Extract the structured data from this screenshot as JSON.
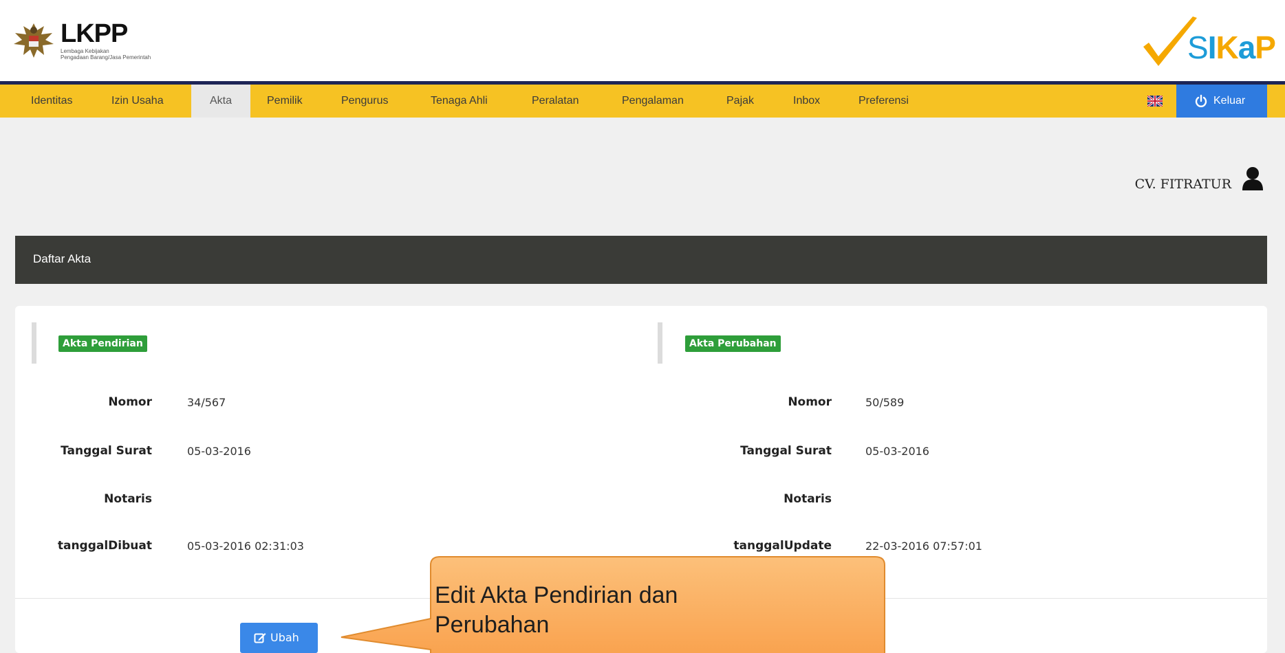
{
  "header": {
    "lkpp_brand": "LKPP",
    "lkpp_subtitle_1": "Lembaga Kebijakan",
    "lkpp_subtitle_2": "Pengadaan Barang/Jasa Pemerintah",
    "sikap_brand": "SIKaP"
  },
  "nav": {
    "items": [
      {
        "label": "Identitas"
      },
      {
        "label": "Izin Usaha"
      },
      {
        "label": "Akta"
      },
      {
        "label": "Pemilik"
      },
      {
        "label": "Pengurus"
      },
      {
        "label": "Tenaga Ahli"
      },
      {
        "label": "Peralatan"
      },
      {
        "label": "Pengalaman"
      },
      {
        "label": "Pajak"
      },
      {
        "label": "Inbox"
      },
      {
        "label": "Preferensi"
      }
    ],
    "active": "Akta",
    "logout_label": "Keluar"
  },
  "user": {
    "name": "CV. FITRATUR"
  },
  "panel": {
    "title": "Daftar Akta",
    "pendirian": {
      "badge": "Akta Pendirian",
      "nomor_label": "Nomor",
      "nomor": "34/567",
      "tanggal_surat_label": "Tanggal Surat",
      "tanggal_surat": "05-03-2016",
      "notaris_label": "Notaris",
      "notaris": "",
      "tanggal_dibuat_label": "tanggalDibuat",
      "tanggal_dibuat": "05-03-2016 02:31:03"
    },
    "perubahan": {
      "badge": "Akta Perubahan",
      "nomor_label": "Nomor",
      "nomor": "50/589",
      "tanggal_surat_label": "Tanggal Surat",
      "tanggal_surat": "05-03-2016",
      "notaris_label": "Notaris",
      "notaris": "",
      "tanggal_update_label": "tanggalUpdate",
      "tanggal_update": "22-03-2016 07:57:01"
    },
    "edit_button_label": "Ubah"
  },
  "callout": {
    "line1": "Edit Akta Pendirian dan",
    "line2": "Perubahan"
  },
  "colors": {
    "navbar": "#f6c223",
    "nav_border": "#1d2556",
    "panel_heading": "#3a3b37",
    "badge_green": "#2e9e3a",
    "button_blue": "#3a88e8",
    "logout_blue": "#2f7be0",
    "callout_fill": "#fbb163"
  },
  "icons": [
    "garuda-emblem",
    "sikap-check-icon",
    "uk-flag-icon",
    "power-icon",
    "user-icon",
    "edit-icon"
  ]
}
